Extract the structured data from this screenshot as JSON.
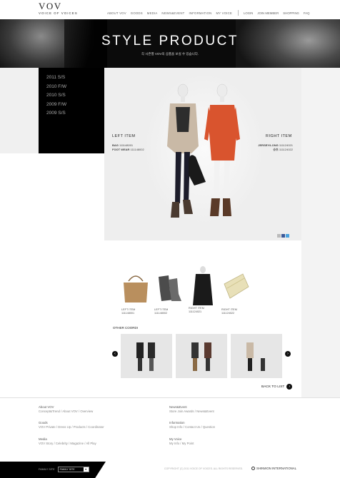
{
  "logo": {
    "mark": "VOV",
    "tagline": "VOICE OF VOICES"
  },
  "nav": {
    "main": [
      "ABOUT VOV",
      "GOODS",
      "MEDIA",
      "NEWS&EVENT",
      "INFORMATION",
      "MY VOICE"
    ],
    "util": [
      "LOGIN",
      "JOIN MEMBER",
      "SHOPPING",
      "FAQ"
    ]
  },
  "banner": {
    "title": "STYLE PRODUCT",
    "subtitle": "각 시즌별 VOV의 상품을 보실 수 있습니다."
  },
  "seasons": [
    "2011 S/S",
    "2010 F/W",
    "2010 S/S",
    "2009 F/W",
    "2009 S/S"
  ],
  "left_item": {
    "label": "LEFT ITEM",
    "lines": [
      {
        "name": "BAG",
        "code": "111148001"
      },
      {
        "name": "FOOT WEAR",
        "code": "111148002"
      }
    ]
  },
  "right_item": {
    "label": "RIGHT ITEM",
    "lines": [
      {
        "name": "JERSEY/LONG",
        "code": "111124021"
      },
      {
        "name": "슈즈",
        "code": "111124022"
      }
    ]
  },
  "products": [
    {
      "label": "LEFT ITEM",
      "code": "111148001"
    },
    {
      "label": "LEFT ITEM",
      "code": "111148002"
    },
    {
      "label": "RIGHT ITEM",
      "code": "111124021"
    },
    {
      "label": "RIGHT ITEM",
      "code": "111124022"
    }
  ],
  "other_coordi": {
    "title": "OTHER COORDI"
  },
  "back_to_list": "BACK TO LIST",
  "footer": {
    "cols": [
      {
        "title": "About VOV",
        "links": "Concept&Trend / About VOV / Overview"
      },
      {
        "title": "Goods",
        "links": "VOV Private / Dress Up / Products / Coordinator"
      },
      {
        "title": "Media",
        "links": "VOV Story / Celebrity / Magazine / All Play"
      },
      {
        "title": "News&Event",
        "links": "Store Join Awards / News&Event"
      },
      {
        "title": "Information",
        "links": "Shop Info / Contact Us / Question"
      },
      {
        "title": "My Voice",
        "links": "My Info / My Point"
      }
    ],
    "family_label": "FAMILY SITE",
    "family_select": "FAMILY SITE",
    "copyright": "COPYRIGHT (C) 2011 VOICE OF VOICES. ALL RIGHTS RESERVED.",
    "company": "SHINWON INTERNATIONAL"
  },
  "colors": {
    "accent": "#000000",
    "dress": "#d9542e",
    "background": "#f0f0f0"
  }
}
